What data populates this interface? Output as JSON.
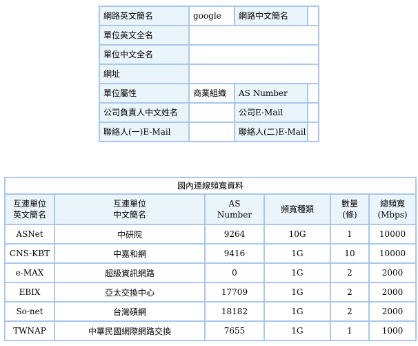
{
  "info_table": {
    "net_en_short_label": "網路英文簡名",
    "net_en_short_value": "google",
    "net_zh_short_label": "網路中文簡名",
    "unit_en_full_label": "單位英文全名",
    "unit_zh_full_label": "單位中文全名",
    "website_label": "網址",
    "unit_type_label": "單位屬性",
    "unit_type_value": "商業組織",
    "as_number_label": "AS Number",
    "owner_zh_name_label": "公司負責人中文姓名",
    "company_email_label": "公司E-Mail",
    "contact1_email_label": "聯絡人(一)E-Mail",
    "contact2_email_label": "聯絡人(二)E-Mail"
  },
  "bandwidth_table": {
    "title": "國內連線頻寬資料",
    "headers": {
      "en_name_line1": "互連單位",
      "en_name_line2": "英文簡名",
      "zh_name_line1": "互連單位",
      "zh_name_line2": "中文簡名",
      "as_line1": "AS",
      "as_line2": "Number",
      "type": "頻寬種類",
      "count_line1": "數量",
      "count_line2": "(條)",
      "total_line1": "總頻寬",
      "total_line2": "(Mbps)"
    },
    "rows": [
      {
        "en": "ASNet",
        "zh": "中研院",
        "as": "9264",
        "type": "10G",
        "count": "1",
        "total": "10000"
      },
      {
        "en": "CNS-KBT",
        "zh": "中嘉和網",
        "as": "9416",
        "type": "1G",
        "count": "10",
        "total": "10000"
      },
      {
        "en": "e-MAX",
        "zh": "超級資訊網路",
        "as": "0",
        "type": "1G",
        "count": "2",
        "total": "2000"
      },
      {
        "en": "EBIX",
        "zh": "亞太交換中心",
        "as": "17709",
        "type": "1G",
        "count": "2",
        "total": "2000"
      },
      {
        "en": "So-net",
        "zh": "台灣碩網",
        "as": "18182",
        "type": "1G",
        "count": "2",
        "total": "2000"
      },
      {
        "en": "TWNAP",
        "zh": "中華民國網際網路交換",
        "as": "7655",
        "type": "1G",
        "count": "1",
        "total": "1000"
      }
    ]
  }
}
